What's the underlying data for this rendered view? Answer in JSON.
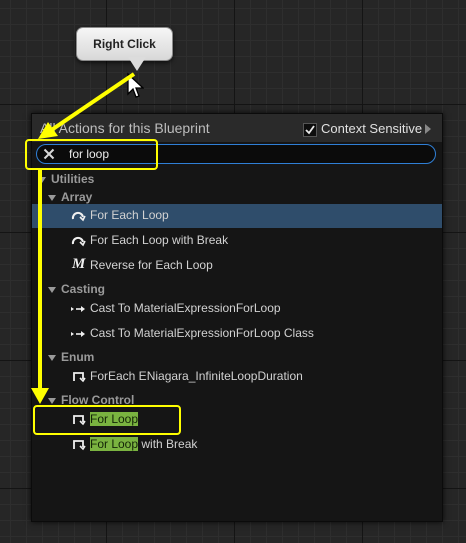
{
  "tooltip": {
    "label": "Right Click"
  },
  "menu": {
    "title": "All Actions for this Blueprint",
    "context_sensitive": {
      "label": "Context Sensitive",
      "checked": true
    },
    "search": {
      "value": "for loop",
      "placeholder": ""
    },
    "categories": {
      "utilities": "Utilities",
      "array": "Array",
      "casting": "Casting",
      "enum": "Enum",
      "flow_control": "Flow Control"
    },
    "items": {
      "for_each_loop": "For Each Loop",
      "for_each_loop_break": "For Each Loop with Break",
      "reverse_for_each": "Reverse for Each Loop",
      "cast_material": "Cast To MaterialExpressionForLoop",
      "cast_material_class": "Cast To MaterialExpressionForLoop Class",
      "foreach_niagara": "ForEach ENiagara_InfiniteLoopDuration",
      "for_loop_hl": "For Loop",
      "for_loop_break_hl": "For Loop",
      "for_loop_break_rest": " with Break"
    }
  },
  "colors": {
    "annotation": "#ffff00",
    "selection": "#2f4d6b",
    "highlight": "#7ab340",
    "search_border": "#2f7fd6"
  }
}
